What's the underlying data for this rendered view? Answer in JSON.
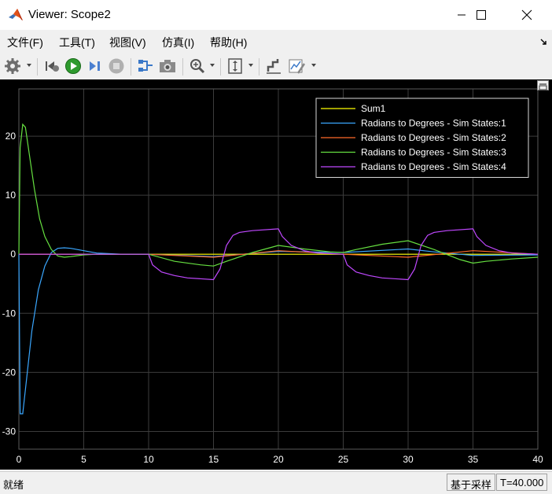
{
  "window": {
    "title": "Viewer: Scope2"
  },
  "menu": [
    "文件(F)",
    "工具(T)",
    "视图(V)",
    "仿真(I)",
    "帮助(H)"
  ],
  "toolbar": {
    "icons": [
      "gear-icon",
      "step-back-icon",
      "run-icon",
      "step-forward-icon",
      "stop-icon",
      "highlight-block-icon",
      "snapshot-icon",
      "zoom-icon",
      "scale-axes-icon",
      "cursor-measurements-icon",
      "signal-statistics-icon"
    ]
  },
  "status": {
    "left": "就绪",
    "sample_mode": "基于采样",
    "time": "T=40.000"
  },
  "colors": {
    "background": "#000000",
    "grid": "#3c3c3c",
    "axis_text": "#ffffff",
    "series": [
      "#ffff00",
      "#3aa7ff",
      "#ff6a2a",
      "#66e040",
      "#c048ff"
    ]
  },
  "chart_data": {
    "type": "line",
    "title": "",
    "xlabel": "",
    "ylabel": "",
    "xlim": [
      0,
      40
    ],
    "ylim": [
      -33,
      28
    ],
    "xticks": [
      0,
      5,
      10,
      15,
      20,
      25,
      30,
      35,
      40
    ],
    "yticks": [
      -30,
      -20,
      -10,
      0,
      10,
      20
    ],
    "grid": true,
    "legend_position": "top-right",
    "series": [
      {
        "name": "Sum1",
        "x": [
          0,
          40
        ],
        "y": [
          0,
          0
        ]
      },
      {
        "name": "Radians to Degrees - Sim States:1",
        "x": [
          0,
          0.1,
          0.3,
          0.6,
          1.0,
          1.5,
          2.0,
          2.5,
          3.0,
          3.5,
          4.0,
          5.0,
          6.0,
          8.0,
          10,
          15,
          20,
          25,
          30,
          32,
          35,
          40
        ],
        "y": [
          0,
          -27,
          -27,
          -21,
          -13,
          -6,
          -2,
          0.3,
          1.0,
          1.1,
          1.0,
          0.6,
          0.2,
          0,
          0,
          -0.4,
          0.5,
          0.3,
          0.9,
          0.4,
          -0.2,
          -0.1
        ]
      },
      {
        "name": "Radians to Degrees - Sim States:2",
        "x": [
          0,
          10,
          15,
          20,
          25,
          30,
          35,
          40
        ],
        "y": [
          0,
          0,
          -0.5,
          0.6,
          0,
          -0.5,
          0.6,
          0
        ]
      },
      {
        "name": "Radians to Degrees - Sim States:3",
        "x": [
          0,
          0.1,
          0.3,
          0.5,
          0.8,
          1.2,
          1.6,
          2.0,
          2.5,
          3.0,
          3.5,
          4.0,
          5.0,
          6.0,
          8.0,
          10,
          12,
          14,
          15,
          16,
          18,
          20,
          22,
          24,
          25,
          26,
          28,
          30,
          32,
          34,
          35,
          36,
          38,
          40
        ],
        "y": [
          0,
          18,
          22,
          21.5,
          17,
          11,
          6,
          3,
          0.8,
          -0.3,
          -0.5,
          -0.4,
          -0.1,
          0,
          0,
          0,
          -1.2,
          -1.8,
          -2.0,
          -1.2,
          0.3,
          1.5,
          0.9,
          0.4,
          0.3,
          0.8,
          1.7,
          2.3,
          0.8,
          -0.9,
          -1.5,
          -1.2,
          -0.8,
          -0.5
        ]
      },
      {
        "name": "Radians to Degrees - Sim States:4",
        "x": [
          0,
          10,
          10.3,
          11,
          12,
          13,
          15,
          15.5,
          16,
          16.5,
          17,
          18,
          20,
          20.3,
          21,
          22,
          23,
          25,
          25.3,
          26,
          27,
          28,
          30,
          30.5,
          31,
          31.5,
          32,
          33,
          35,
          35.3,
          36,
          37,
          38,
          40
        ],
        "y": [
          0,
          0,
          -1.8,
          -3.0,
          -3.6,
          -4.0,
          -4.3,
          -2.5,
          1.5,
          3.2,
          3.7,
          4.0,
          4.3,
          3.0,
          1.5,
          0.6,
          0.2,
          0,
          -1.8,
          -3.0,
          -3.6,
          -4.0,
          -4.3,
          -2.5,
          1.5,
          3.2,
          3.7,
          4.0,
          4.3,
          3.0,
          1.5,
          0.6,
          0.2,
          0
        ]
      }
    ]
  }
}
